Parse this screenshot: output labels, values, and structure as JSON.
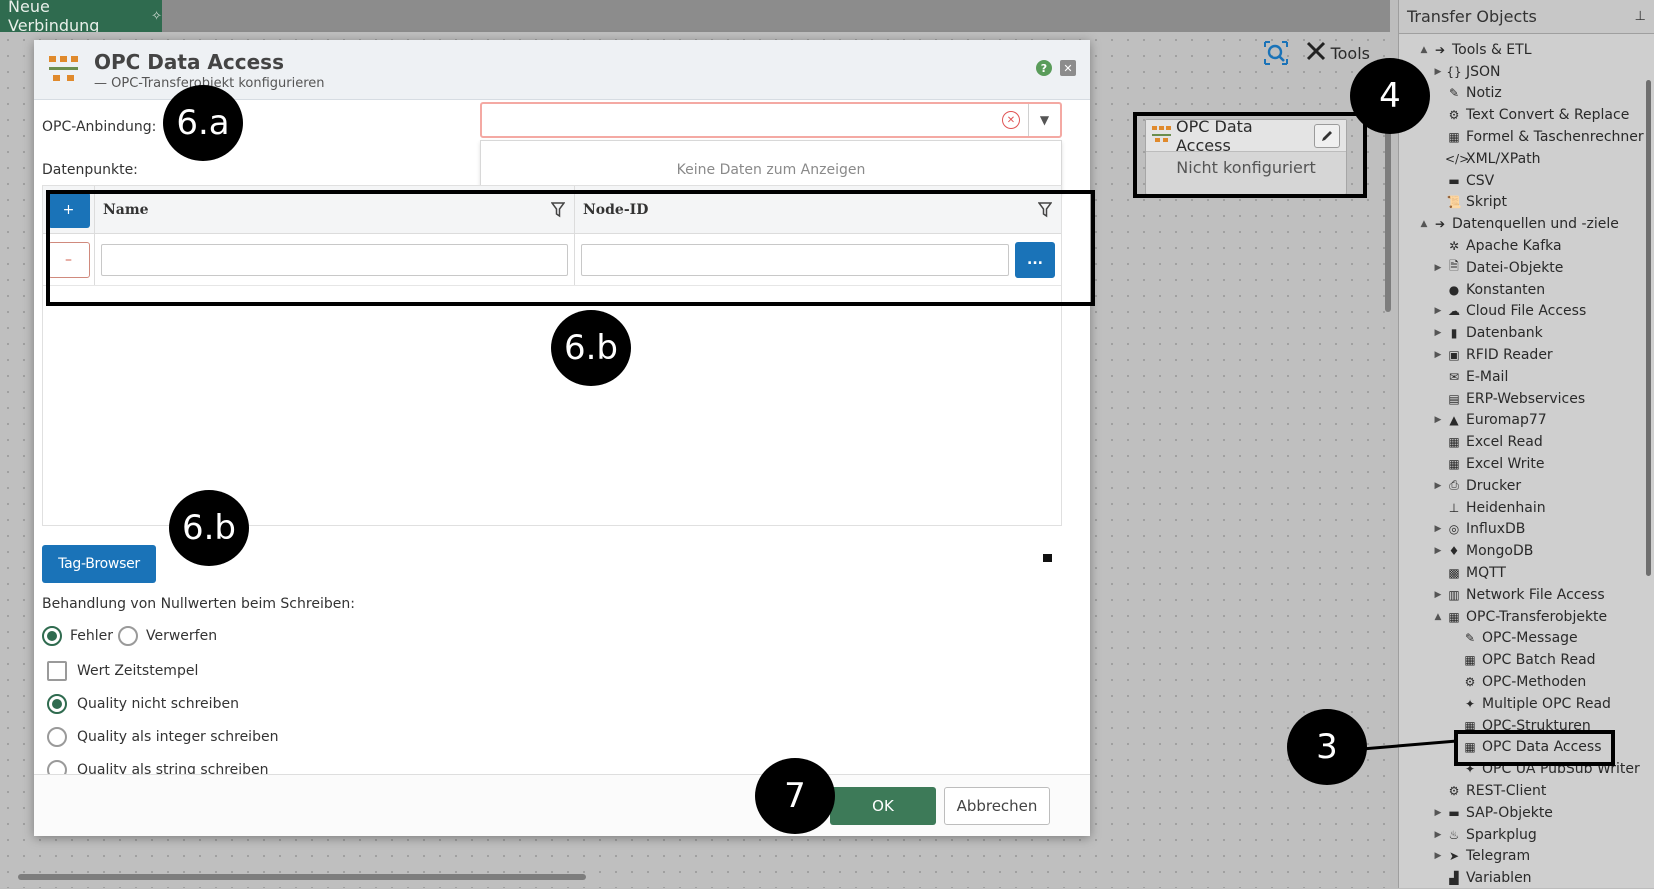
{
  "tab": {
    "label": "Neue Verbindung"
  },
  "toolbar": {
    "tools_label": "Tools"
  },
  "canvas_node": {
    "title": "OPC Data Access",
    "status": "Nicht konfiguriert"
  },
  "panel": {
    "title": "Transfer Objects",
    "items": [
      {
        "label": "Tools & ETL",
        "level": 0,
        "arrow": "▲",
        "icon": "➔"
      },
      {
        "label": "JSON",
        "level": 1,
        "arrow": "▶",
        "icon": "{}"
      },
      {
        "label": "Notiz",
        "level": 1,
        "arrow": "",
        "icon": "✎"
      },
      {
        "label": "Text Convert & Replace",
        "level": 1,
        "arrow": "",
        "icon": "⚙"
      },
      {
        "label": "Formel & Taschenrechner",
        "level": 1,
        "arrow": "",
        "icon": "▦"
      },
      {
        "label": "XML/XPath",
        "level": 1,
        "arrow": "",
        "icon": "</>"
      },
      {
        "label": "CSV",
        "level": 1,
        "arrow": "",
        "icon": "▬"
      },
      {
        "label": "Skript",
        "level": 1,
        "arrow": "",
        "icon": "📜"
      },
      {
        "label": "Datenquellen und -ziele",
        "level": 0,
        "arrow": "▲",
        "icon": "➔"
      },
      {
        "label": "Apache Kafka",
        "level": 1,
        "arrow": "",
        "icon": "✲"
      },
      {
        "label": "Datei-Objekte",
        "level": 1,
        "arrow": "▶",
        "icon": "🗎"
      },
      {
        "label": "Konstanten",
        "level": 1,
        "arrow": "",
        "icon": "●"
      },
      {
        "label": "Cloud File Access",
        "level": 1,
        "arrow": "▶",
        "icon": "☁"
      },
      {
        "label": "Datenbank",
        "level": 1,
        "arrow": "▶",
        "icon": "▮"
      },
      {
        "label": "RFID Reader",
        "level": 1,
        "arrow": "▶",
        "icon": "▣"
      },
      {
        "label": "E-Mail",
        "level": 1,
        "arrow": "",
        "icon": "✉"
      },
      {
        "label": "ERP-Webservices",
        "level": 1,
        "arrow": "",
        "icon": "▤"
      },
      {
        "label": "Euromap77",
        "level": 1,
        "arrow": "▶",
        "icon": "▲"
      },
      {
        "label": "Excel Read",
        "level": 1,
        "arrow": "",
        "icon": "▦"
      },
      {
        "label": "Excel Write",
        "level": 1,
        "arrow": "",
        "icon": "▦"
      },
      {
        "label": "Drucker",
        "level": 1,
        "arrow": "▶",
        "icon": "⎙"
      },
      {
        "label": "Heidenhain",
        "level": 1,
        "arrow": "",
        "icon": "⊥"
      },
      {
        "label": "InfluxDB",
        "level": 1,
        "arrow": "▶",
        "icon": "◎"
      },
      {
        "label": "MongoDB",
        "level": 1,
        "arrow": "▶",
        "icon": "♦"
      },
      {
        "label": "MQTT",
        "level": 1,
        "arrow": "",
        "icon": "▩"
      },
      {
        "label": "Network File Access",
        "level": 1,
        "arrow": "▶",
        "icon": "▥"
      },
      {
        "label": "OPC-Transferobjekte",
        "level": 1,
        "arrow": "▲",
        "icon": "▦"
      },
      {
        "label": "OPC-Message",
        "level": 2,
        "arrow": "",
        "icon": "✎"
      },
      {
        "label": "OPC Batch Read",
        "level": 2,
        "arrow": "",
        "icon": "▦"
      },
      {
        "label": "OPC-Methoden",
        "level": 2,
        "arrow": "",
        "icon": "⚙"
      },
      {
        "label": "Multiple OPC Read",
        "level": 2,
        "arrow": "",
        "icon": "✦"
      },
      {
        "label": "OPC-Strukturen",
        "level": 2,
        "arrow": "",
        "icon": "▦"
      },
      {
        "label": "OPC Data Access",
        "level": 2,
        "arrow": "",
        "icon": "▦"
      },
      {
        "label": "OPC UA PubSub Writer",
        "level": 2,
        "arrow": "",
        "icon": "✦"
      },
      {
        "label": "REST-Client",
        "level": 1,
        "arrow": "",
        "icon": "⚙"
      },
      {
        "label": "SAP-Objekte",
        "level": 1,
        "arrow": "▶",
        "icon": "▬"
      },
      {
        "label": "Sparkplug",
        "level": 1,
        "arrow": "▶",
        "icon": "♨"
      },
      {
        "label": "Telegram",
        "level": 1,
        "arrow": "▶",
        "icon": "➤"
      },
      {
        "label": "Variablen",
        "level": 1,
        "arrow": "",
        "icon": "▟"
      }
    ]
  },
  "dialog": {
    "title": "OPC Data Access",
    "subtitle": "— OPC-Transferobjekt konfigurieren",
    "opc_label": "OPC-Anbindung:",
    "opc_value": "",
    "dropdown_empty": "Keine Daten zum Anzeigen",
    "datapoints_label": "Datenpunkte:",
    "grid": {
      "col_name": "Name",
      "col_node": "Node-ID",
      "add": "+",
      "remove": "–",
      "browse": "...",
      "name_value": "",
      "node_value": ""
    },
    "tag_browser": "Tag-Browser",
    "null_label": "Behandlung von Nullwerten beim Schreiben:",
    "radio_fehler": "Fehler",
    "radio_verwerfen": "Verwerfen",
    "checkbox_timestamp": "Wert Zeitstempel",
    "quality_none": "Quality nicht schreiben",
    "quality_int": "Quality als integer schreiben",
    "quality_string": "Quality als string schreiben",
    "ok": "OK",
    "cancel": "Abbrechen"
  },
  "annotations": {
    "b6a": "6.a",
    "b6b_top": "6.b",
    "b6b_bottom": "6.b",
    "b4": "4",
    "b3": "3",
    "b7": "7"
  },
  "colors": {
    "accent_blue": "#1a73b8",
    "accent_green": "#3d7a58",
    "tab_green": "#2f6b4f"
  }
}
